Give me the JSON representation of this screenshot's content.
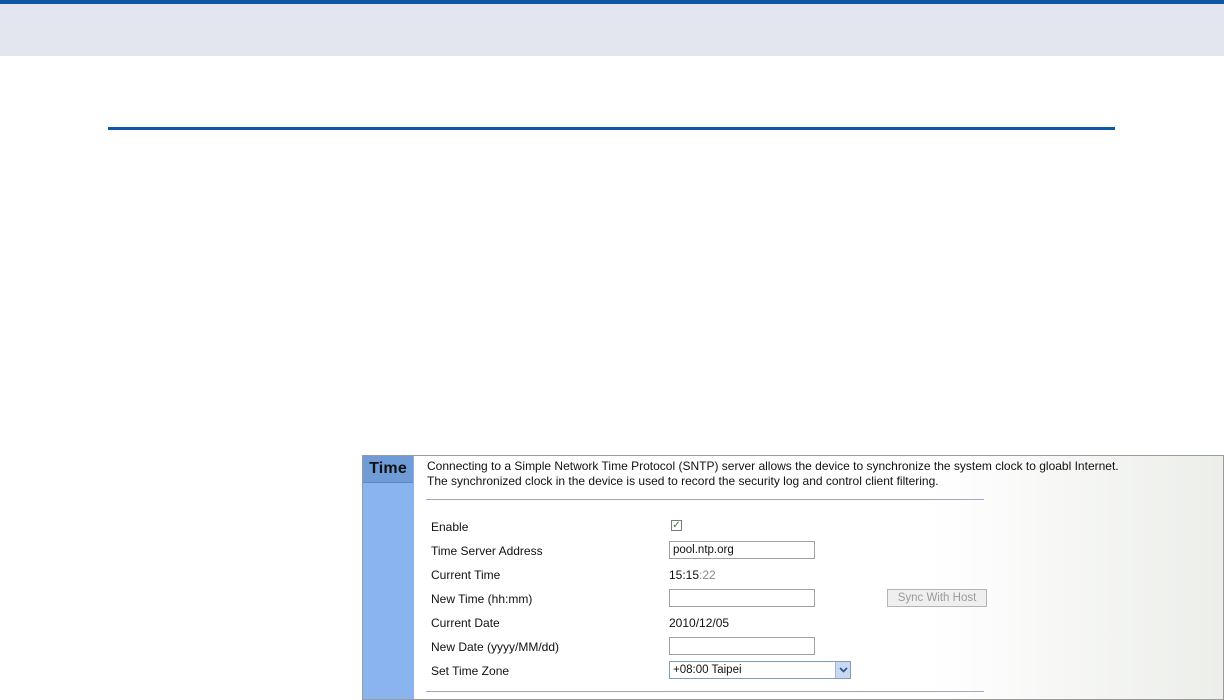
{
  "panel": {
    "tab_title": "Time",
    "description_line1": "Connecting to a Simple Network Time Protocol (SNTP) server allows the device to synchronize the system clock to gloabl Internet.",
    "description_line2": "The synchronized clock in the device is used to record the security log and control client filtering."
  },
  "form": {
    "enable": {
      "label": "Enable",
      "checked": true
    },
    "time_server": {
      "label": "Time Server Address",
      "value": "pool.ntp.org"
    },
    "current_time": {
      "label": "Current Time",
      "value_hm": "15:15",
      "value_sec": ":22"
    },
    "new_time": {
      "label": "New Time (hh:mm)",
      "value": "",
      "button_label": "Sync With Host"
    },
    "current_date": {
      "label": "Current Date",
      "value": "2010/12/05"
    },
    "new_date": {
      "label": "New Date (yyyy/MM/dd)",
      "value": ""
    },
    "time_zone": {
      "label": "Set Time Zone",
      "selected": "+08:00 Taipei"
    }
  },
  "icons": {
    "checkbox": "check-icon",
    "dropdown": "chevron-down-icon"
  },
  "colors": {
    "accent_blue": "#0d57a3",
    "sidebar_blue": "#8ab4f0",
    "tab_blue": "#6f9bd6",
    "checkmark_green": "#1d8a24"
  }
}
